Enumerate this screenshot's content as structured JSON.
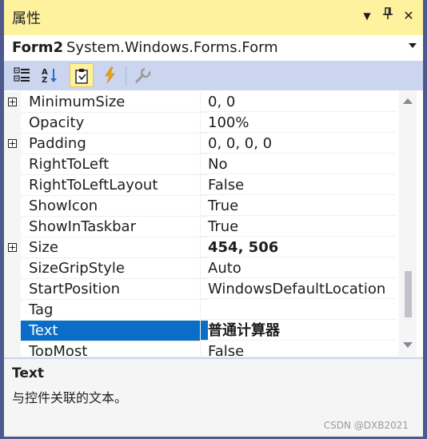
{
  "titlebar": {
    "title": "属性",
    "buttons": [
      "dropdown-icon",
      "pin-icon",
      "close-icon"
    ],
    "dropdown_glyph": "▼",
    "pin_glyph": "▐",
    "close_glyph": "✕"
  },
  "object_selector": {
    "name": "Form2",
    "type": "System.Windows.Forms.Form"
  },
  "toolbar": {
    "tools": [
      "categorized-icon",
      "alphabetical-icon",
      "properties-icon",
      "events-icon",
      "property-pages-icon"
    ],
    "active": "properties-icon"
  },
  "grid": {
    "rows": [
      {
        "name": "MinimumSize",
        "value": "0, 0",
        "expandable": true,
        "bold": false
      },
      {
        "name": "Opacity",
        "value": "100%",
        "expandable": false,
        "bold": false
      },
      {
        "name": "Padding",
        "value": "0, 0, 0, 0",
        "expandable": true,
        "bold": false
      },
      {
        "name": "RightToLeft",
        "value": "No",
        "expandable": false,
        "bold": false
      },
      {
        "name": "RightToLeftLayout",
        "value": "False",
        "expandable": false,
        "bold": false
      },
      {
        "name": "ShowIcon",
        "value": "True",
        "expandable": false,
        "bold": false
      },
      {
        "name": "ShowInTaskbar",
        "value": "True",
        "expandable": false,
        "bold": false
      },
      {
        "name": "Size",
        "value": "454, 506",
        "expandable": true,
        "bold": true
      },
      {
        "name": "SizeGripStyle",
        "value": "Auto",
        "expandable": false,
        "bold": false
      },
      {
        "name": "StartPosition",
        "value": "WindowsDefaultLocation",
        "expandable": false,
        "bold": false
      },
      {
        "name": "Tag",
        "value": "",
        "expandable": false,
        "bold": false
      },
      {
        "name": "Text",
        "value": "普通计算器",
        "expandable": false,
        "bold": true,
        "selected": true
      },
      {
        "name": "TopMost",
        "value": "False",
        "expandable": false,
        "bold": false
      }
    ]
  },
  "description": {
    "title": "Text",
    "text": "与控件关联的文本。"
  },
  "watermark": "CSDN @DXB2021",
  "colors": {
    "titlebar": "#fff29e",
    "toolbar": "#ccd5f0",
    "selection": "#0a6ec8",
    "frame": "#4e5a8e"
  }
}
